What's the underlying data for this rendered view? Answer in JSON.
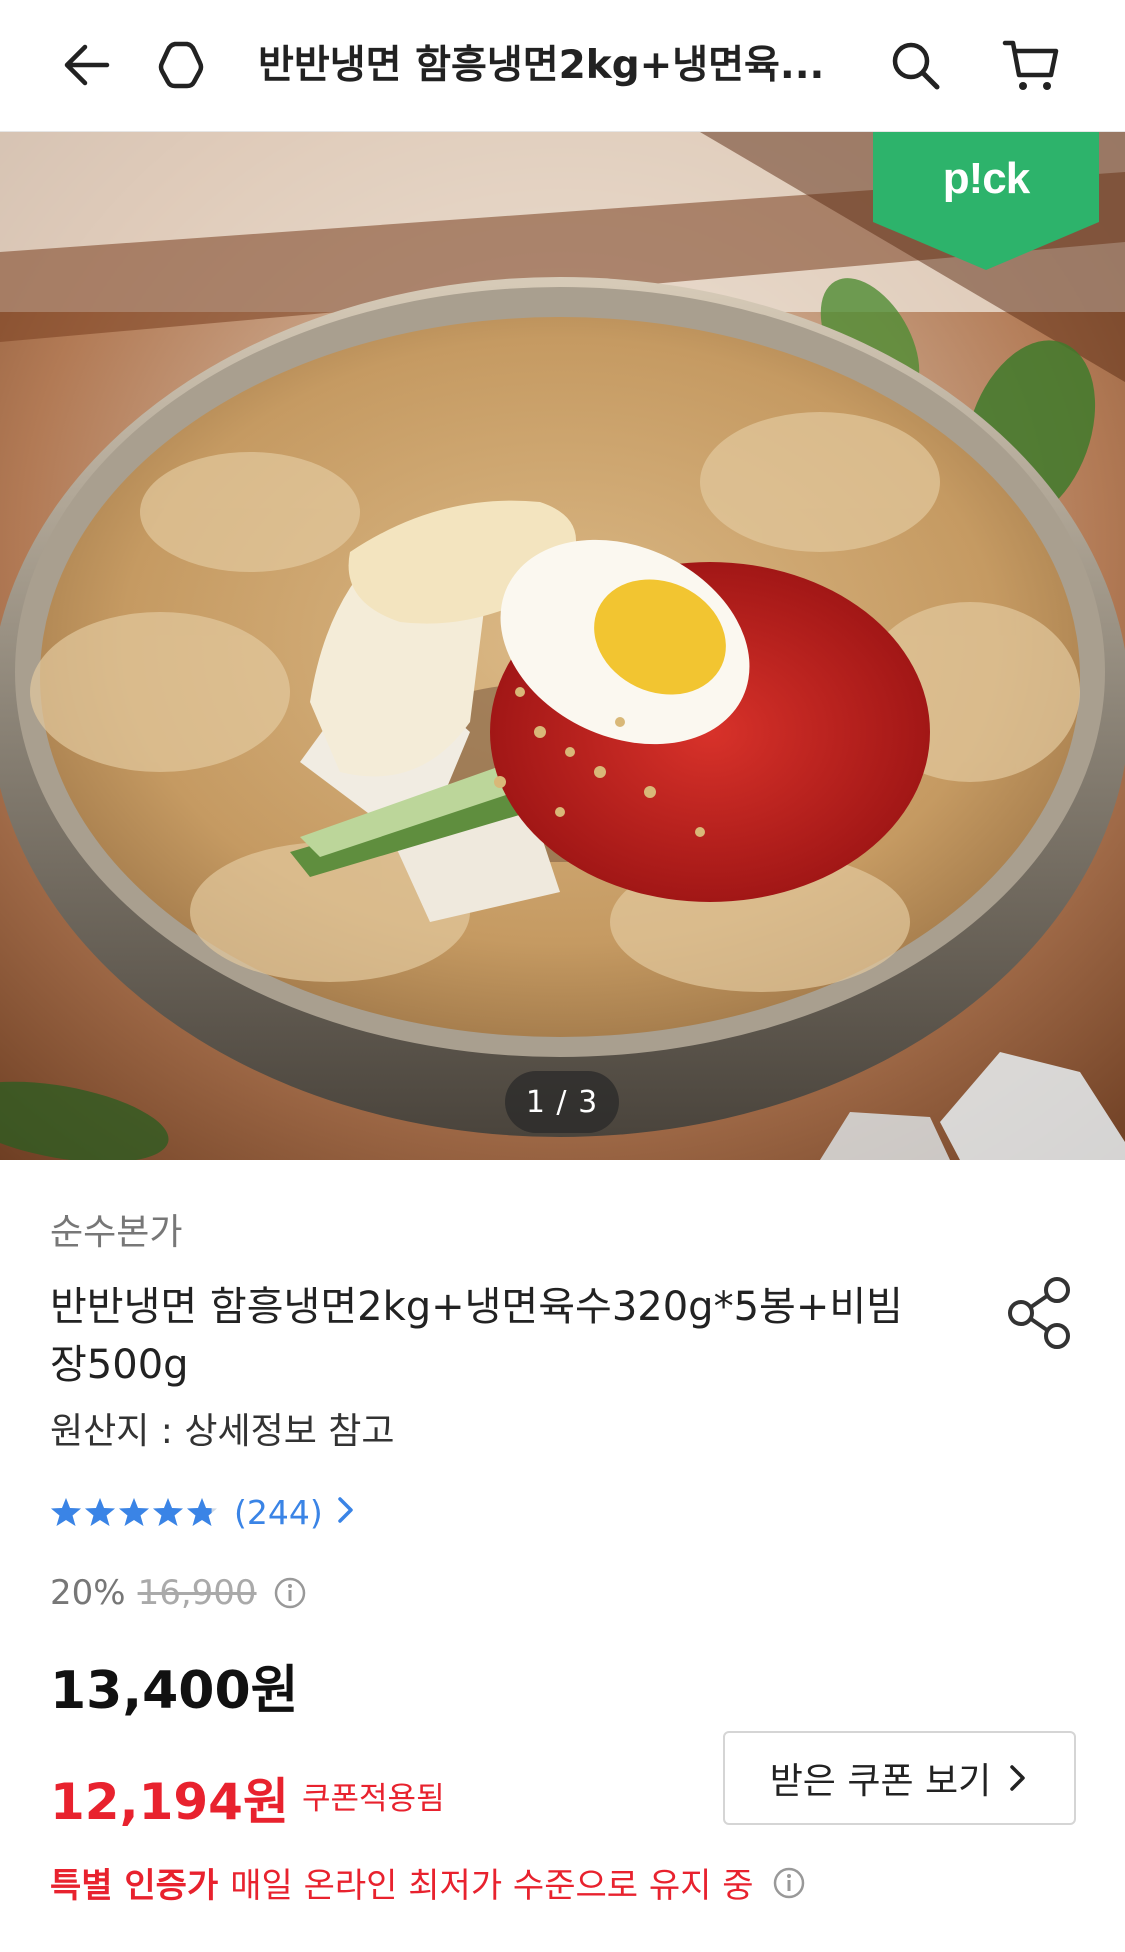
{
  "header": {
    "title": "반반냉면 함흥냉면2kg+냉면육...",
    "back_icon": "arrow-left-icon",
    "home_icon": "home-icon",
    "search_icon": "search-icon",
    "cart_icon": "cart-icon"
  },
  "hero": {
    "badge_text": "p!ck",
    "pager": "1 / 3"
  },
  "product": {
    "brand": "순수본가",
    "title": "반반냉면 함흥냉면2kg+냉면육수320g*5봉+비빔장500g",
    "origin": "원산지 : 상세정보 참고",
    "rating": 4.8,
    "review_count": "(244)",
    "discount": "20%",
    "original_price": "16,900",
    "price": "13,400원",
    "coupon_price": "12,194원",
    "coupon_label": "쿠폰적용됨",
    "coupon_button": "받은 쿠폰 보기",
    "lowest_strong": "특별 인증가",
    "lowest_text": "매일 온라인 최저가 수준으로 유지 중"
  },
  "colors": {
    "accent_red": "#e8222e",
    "link_blue": "#3a84e6",
    "pick_green": "#2db36b"
  }
}
